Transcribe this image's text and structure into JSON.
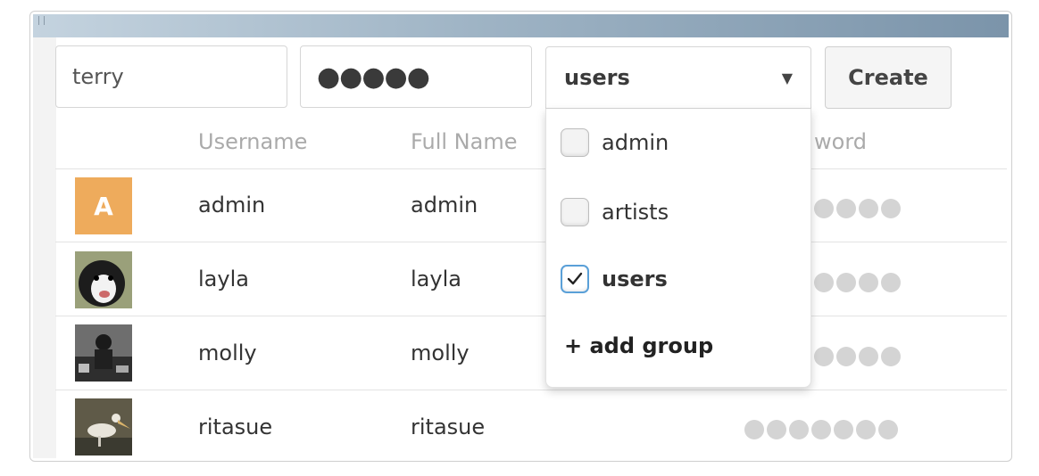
{
  "form": {
    "username_value": "terry",
    "password_value": "●●●●●",
    "group_select_value": "users",
    "create_label": "Create"
  },
  "table": {
    "headers": [
      "Username",
      "Full Name",
      "Password"
    ],
    "header_password_visible": "word",
    "rows": [
      {
        "avatar": "A",
        "avatar_color": "#eeab5c",
        "username": "admin",
        "fullname": "admin",
        "password_dots": 4
      },
      {
        "avatar": "dog-photo",
        "username": "layla",
        "fullname": "layla",
        "password_dots": 4
      },
      {
        "avatar": "bw-photo",
        "username": "molly",
        "fullname": "molly",
        "password_dots": 4
      },
      {
        "avatar": "pelican-photo",
        "username": "ritasue",
        "fullname": "ritasue",
        "password_dots": 7
      }
    ]
  },
  "dropdown": {
    "options": [
      {
        "label": "admin",
        "checked": false
      },
      {
        "label": "artists",
        "checked": false
      },
      {
        "label": "users",
        "checked": true
      }
    ],
    "add_group_label": "+ add group"
  },
  "colors": {
    "accent": "#5aa0d8",
    "avatar_orange": "#eeab5c",
    "topbar": "#7b94aa"
  }
}
